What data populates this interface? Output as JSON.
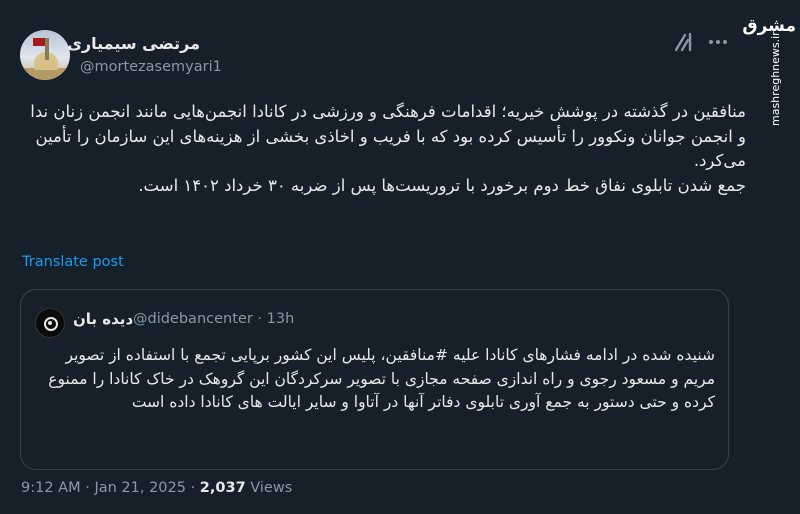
{
  "author": {
    "name": "مرتضی سیمیاری",
    "handle": "@mortezasemyari1"
  },
  "tweet": {
    "paragraph1": "منافقین در گذشته در پوشش خیریه؛ اقدامات فرهنگی و ورزشی در کانادا انجمن‌هایی مانند انجمن زنان ندا و انجمن جوانان ونکوور را تأسیس کرده بود که با فریب و اخاذی بخشی از هزینه‌های این سازمان را تأمین می‌کرد.",
    "paragraph2": "جمع شدن تابلوی نفاق خط دوم برخورد با تروریست‌ها پس از ضربه ۳۰ خرداد ۱۴۰۲ است.",
    "translate_label": "Translate post"
  },
  "quote": {
    "name": "دیده بان",
    "handle": "@didebancenter",
    "separator": "·",
    "time": "13h",
    "text": "شنیده شده در ادامه فشارهای کانادا علیه #منافقین، پلیس این کشور برپایی تجمع با استفاده از تصویر مریم و مسعود رجوی و راه اندازی صفحه مجازی با تصویر سرکردگان این گروهک در خاک کانادا را ممنوع کرده و حتی دستور به جمع آوری تابلوی دفاتر آنها در آتاوا و سایر ایالت های کانادا داده است"
  },
  "meta": {
    "time": "9:12 AM",
    "separator": "·",
    "date": "Jan 21, 2025",
    "views_count": "2,037",
    "views_label": "Views"
  },
  "watermark": {
    "logo": "مشرق",
    "url": "mashreghnews.ir"
  },
  "icons": {
    "grok": "grok-icon",
    "more": "more-icon"
  },
  "colors": {
    "background": "#15202b",
    "text": "#e7e9ea",
    "secondary": "#8b98a5",
    "link": "#1d9bf0",
    "border": "#38444d"
  }
}
